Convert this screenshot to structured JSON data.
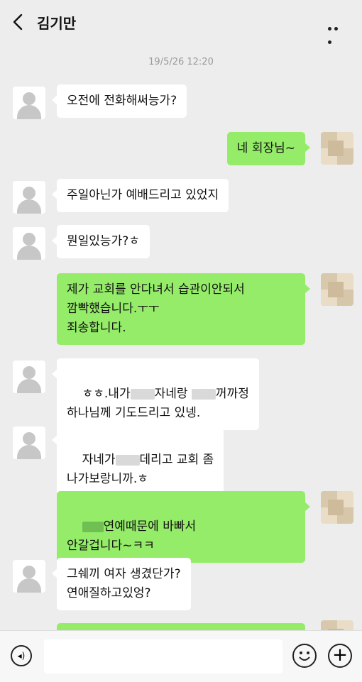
{
  "header": {
    "title": "김기만"
  },
  "timestamp": "19/5/26 12:20",
  "messages": [
    {
      "side": "left",
      "text": "오전에 전화해써능가?"
    },
    {
      "side": "right",
      "text": "네 회장님~"
    },
    {
      "side": "left",
      "text": "주일아닌가 예배드리고 있었지"
    },
    {
      "side": "left",
      "text": "뭔일있능가?ㅎ"
    },
    {
      "side": "right",
      "text": "제가 교회를 안다녀서 습관이안되서\n깜빡했습니다.ㅜㅜ\n죄송합니다."
    },
    {
      "side": "left",
      "line1a": "ㅎㅎ.내가",
      "line1b": "자네랑",
      "line1c": "꺼까정",
      "line2": "하나님께 기도드리고 있넹."
    },
    {
      "side": "left",
      "line1a": "자네가",
      "line1b": "데리고 교회 좀",
      "line2": "나가보랑니까.ㅎ"
    },
    {
      "side": "right",
      "line1": "연예때문에 바빠서",
      "line2": "안갈겁니다~ㅋㅋ"
    },
    {
      "side": "left",
      "text": "그쉐끼 여자 생겼단가?\n연애질하고있엉?"
    }
  ],
  "icons": {
    "back": "back-arrow-icon",
    "more": "more-dots-icon",
    "voice": "voice-icon",
    "emoji": "emoji-icon",
    "plus": "plus-icon"
  }
}
